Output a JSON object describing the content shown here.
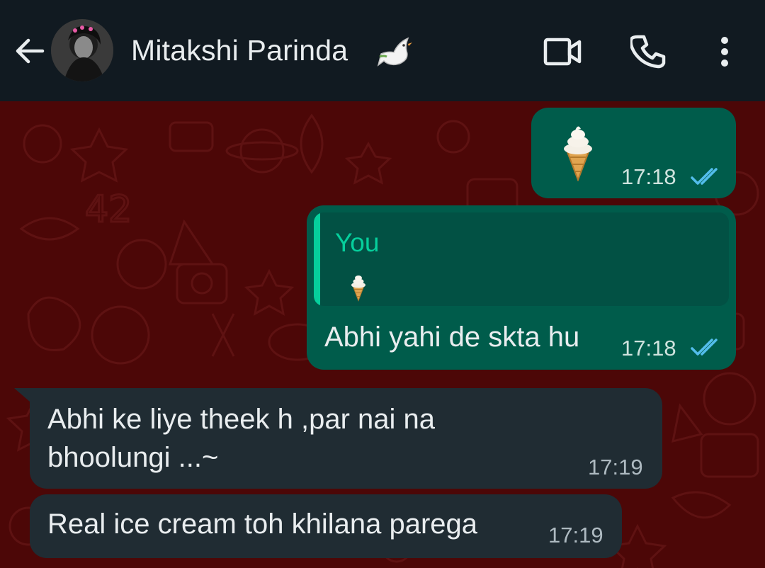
{
  "header": {
    "contact_name": "Mitakshi Parinda",
    "icons": [
      "back-arrow-icon",
      "avatar",
      "dove-icon",
      "video-call-icon",
      "voice-call-icon",
      "more-options-icon"
    ]
  },
  "messages": [
    {
      "direction": "outgoing",
      "type": "emoji",
      "emoji": "🍦",
      "time": "17:18",
      "status": "read"
    },
    {
      "direction": "outgoing",
      "type": "reply",
      "quote_author": "You",
      "quote_emoji": "🍦",
      "text": "Abhi yahi de skta hu",
      "time": "17:18",
      "status": "read"
    },
    {
      "direction": "incoming",
      "type": "text",
      "lines": [
        "Abhi ke liye theek h ,par nai na",
        "bhoolungi ...~"
      ],
      "time": "17:19"
    },
    {
      "direction": "incoming",
      "type": "text",
      "text": "Real ice cream toh khilana parega",
      "time": "17:19"
    }
  ],
  "colors": {
    "header_bg": "#111a21",
    "wallpaper": "#4c0707",
    "outgoing_bubble": "#005c4b",
    "incoming_bubble": "#202c33",
    "accent": "#06cf9c",
    "read_ticks": "#53bdeb"
  }
}
